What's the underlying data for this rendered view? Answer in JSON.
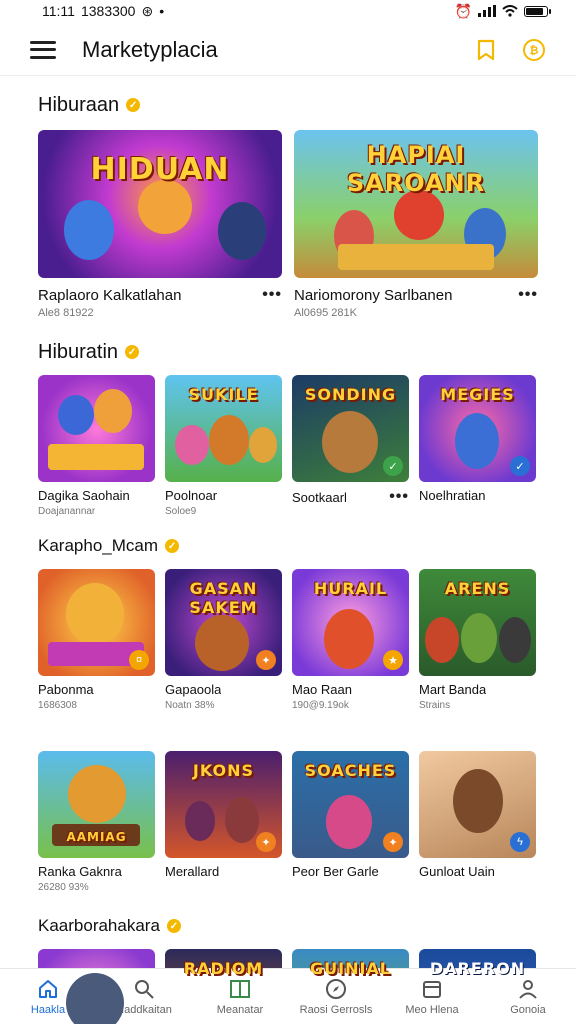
{
  "status_bar": {
    "time": "11:11",
    "extra": "1383300"
  },
  "app_bar": {
    "title": "Marketyplacia"
  },
  "sections": [
    {
      "title": "Hiburaan",
      "cards": [
        {
          "thumb_text": "HIDUAN",
          "title": "Raplaoro Kalkatlahan",
          "subtitle": "Ale8 81922"
        },
        {
          "thumb_text": "HAPIAI SAROANR",
          "title": "Nariomorony Sarlbanen",
          "subtitle": "Al0695 281K"
        }
      ]
    },
    {
      "title": "Hiburatin",
      "cards": [
        {
          "thumb_text": "",
          "title": "Dagika Saohain",
          "subtitle": "Doajanannar"
        },
        {
          "thumb_text": "SUKILE",
          "title": "Poolnoar",
          "subtitle": "Soloe9"
        },
        {
          "thumb_text": "SONDING",
          "title": "Sootkaarl",
          "subtitle": ""
        },
        {
          "thumb_text": "MEGIES",
          "title": "Noelhratian",
          "subtitle": ""
        }
      ]
    },
    {
      "title": "Karapho_Mcam",
      "cards": [
        {
          "thumb_text": "",
          "title": "Pabonma",
          "subtitle": "1686308"
        },
        {
          "thumb_text": "GASAN SAKEM",
          "title": "Gapaoola",
          "subtitle": "Noatn 38%"
        },
        {
          "thumb_text": "HURAIL",
          "title": "Mao Raan",
          "subtitle": "190@9.19ok"
        },
        {
          "thumb_text": "ARENS",
          "title": "Mart Banda",
          "subtitle": "Strains"
        }
      ]
    },
    {
      "title": "",
      "cards": [
        {
          "thumb_text": "AAMIAG",
          "title": "Ranka Gaknra",
          "subtitle": "26280 93%"
        },
        {
          "thumb_text": "JKONS",
          "title": "Merallard",
          "subtitle": ""
        },
        {
          "thumb_text": "SOACHES",
          "title": "Peor Ber Garle",
          "subtitle": ""
        },
        {
          "thumb_text": "",
          "title": "Gunloat Uain",
          "subtitle": ""
        }
      ]
    },
    {
      "title": "Kaarborahakara",
      "cards": [
        {
          "thumb_text": "",
          "title": "",
          "subtitle": ""
        },
        {
          "thumb_text": "RADIOM",
          "title": "",
          "subtitle": ""
        },
        {
          "thumb_text": "GUINIAL",
          "title": "",
          "subtitle": ""
        },
        {
          "thumb_text": "DARERON",
          "title": "",
          "subtitle": ""
        }
      ]
    }
  ],
  "more_label": "•••",
  "bottom_nav": [
    {
      "label": "Haakla",
      "icon": "home-icon"
    },
    {
      "label": "Naddkaitan",
      "icon": "search-icon"
    },
    {
      "label": "Meanatar",
      "icon": "book-icon"
    },
    {
      "label": "Raosi Gerrosls",
      "icon": "compass-icon"
    },
    {
      "label": "Meo Hlena",
      "icon": "calendar-icon"
    },
    {
      "label": "Gonoia",
      "icon": "profile-icon"
    }
  ],
  "colors": {
    "accent": "#f5b800",
    "nav_active": "#1e6fd9"
  }
}
